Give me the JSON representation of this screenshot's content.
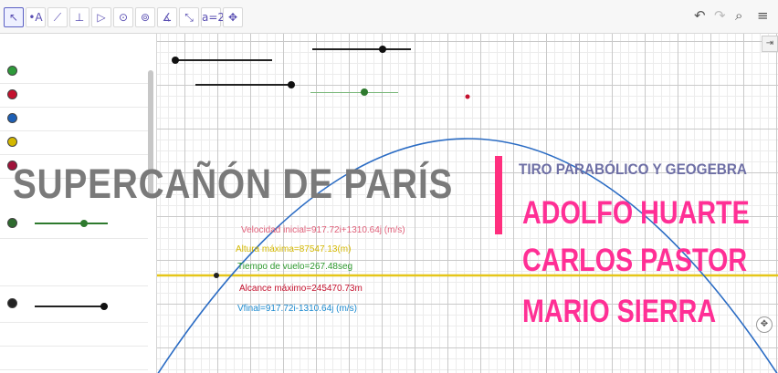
{
  "toolbar": {
    "tools": [
      {
        "icon": "move-tool-icon",
        "glyph": "↖",
        "active": true
      },
      {
        "icon": "point-tool-icon",
        "glyph": "•A"
      },
      {
        "icon": "line-tool-icon",
        "glyph": "⟋"
      },
      {
        "icon": "perpendicular-tool-icon",
        "glyph": "⊥"
      },
      {
        "icon": "polygon-tool-icon",
        "glyph": "▷"
      },
      {
        "icon": "circle-tool-icon",
        "glyph": "⊙"
      },
      {
        "icon": "ellipse-tool-icon",
        "glyph": "⊚"
      },
      {
        "icon": "angle-tool-icon",
        "glyph": "∡"
      },
      {
        "icon": "reflect-tool-icon",
        "glyph": "⤡"
      },
      {
        "icon": "text-tool-icon",
        "glyph": "a=2"
      },
      {
        "icon": "move-graphics-tool-icon",
        "glyph": "✥"
      }
    ],
    "right": {
      "undo": "↶",
      "redo": "↷",
      "search": "⌕",
      "menu": "≡"
    }
  },
  "colors": {
    "curve": "#2b6cc4",
    "axis": "#e5c619",
    "title": "#7a7a7a",
    "accent": "#ff2f7e",
    "author": "#ff2f95",
    "subtitle": "#6e6fa5",
    "vel_inicial": "#e0607a",
    "altura": "#d4b800",
    "tiempo": "#2f9a2f",
    "alcance": "#c4112e",
    "vfinal": "#1d8bd0"
  },
  "overlay": {
    "title": "SUPERCAÑÓN DE PARÍS",
    "subtitle": "TIRO PARABÓLICO Y GEOGEBRA",
    "authors": [
      "ADOLFO HUARTE",
      "CARLOS PASTOR",
      "MARIO SIERRA"
    ]
  },
  "graph": {
    "annotations": {
      "vel_inicial": "Velocidad inicial=917.72i+1310.64j (m/s)",
      "altura": "Altura máxima=87547.13(m)",
      "tiempo": "Tiempo de vuelo=267.48seg",
      "alcance": "Alcance máximo=245470.73m",
      "vfinal": "Vfinal=917.72i-1310.64j (m/s)"
    }
  }
}
